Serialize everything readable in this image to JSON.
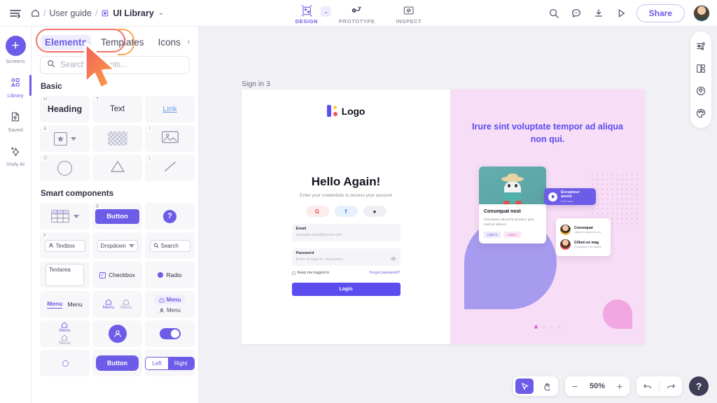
{
  "topbar": {
    "menu_icon": "hamburger-icon",
    "breadcrumb": {
      "home": "home-icon",
      "sep": "/",
      "project": "User guide",
      "file_icon": "file-icon",
      "file": "UI Library",
      "chevron": "⌄"
    },
    "modes": [
      {
        "label": "DESIGN",
        "icon": "design-icon",
        "active": true,
        "chevron": "⌄"
      },
      {
        "label": "PROTOTYPE",
        "icon": "prototype-icon",
        "active": false
      },
      {
        "label": "INSPECT",
        "icon": "inspect-icon",
        "active": false
      }
    ],
    "actions": [
      {
        "name": "search-icon"
      },
      {
        "name": "comment-icon"
      },
      {
        "name": "download-icon"
      },
      {
        "name": "present-icon"
      }
    ],
    "share_label": "Share",
    "avatar": "user-avatar"
  },
  "rail": {
    "items": [
      {
        "label": "Screens",
        "icon": "plus-icon",
        "active": false
      },
      {
        "label": "Library",
        "icon": "library-icon",
        "active": true
      },
      {
        "label": "Saved",
        "icon": "saved-icon",
        "active": false
      },
      {
        "label": "Visily AI",
        "icon": "sparkle-icon",
        "active": false
      }
    ]
  },
  "panel": {
    "tabs": [
      {
        "label": "Elements",
        "active": true
      },
      {
        "label": "Templates",
        "active": false
      },
      {
        "label": "Icons",
        "active": false
      }
    ],
    "collapse_icon": "chevron-left-icon",
    "search": {
      "placeholder": "Search elements...",
      "icon": "search-icon",
      "value": ""
    },
    "sections": [
      {
        "title": "Basic",
        "items": [
          {
            "name": "heading",
            "label": "Heading",
            "kbd": "H"
          },
          {
            "name": "text",
            "label": "Text",
            "kbd": "T"
          },
          {
            "name": "link",
            "label": "Link",
            "kbd": ""
          },
          {
            "name": "icon",
            "label": "",
            "kbd": "A"
          },
          {
            "name": "rectangle",
            "label": "",
            "kbd": ""
          },
          {
            "name": "image",
            "label": "",
            "kbd": "I"
          },
          {
            "name": "circle",
            "label": "",
            "kbd": "O"
          },
          {
            "name": "triangle",
            "label": "",
            "kbd": ""
          },
          {
            "name": "line",
            "label": "",
            "kbd": "L"
          }
        ]
      },
      {
        "title": "Smart components",
        "items": [
          {
            "name": "table",
            "label": "",
            "kbd": ""
          },
          {
            "name": "button",
            "label": "Button",
            "kbd": "B"
          },
          {
            "name": "tooltip",
            "label": "?",
            "kbd": ""
          },
          {
            "name": "textbox",
            "label": "Textbox",
            "kbd": "F"
          },
          {
            "name": "dropdown",
            "label": "Dropdown",
            "kbd": ""
          },
          {
            "name": "search",
            "label": "Search",
            "kbd": ""
          },
          {
            "name": "textarea",
            "label": "Textarea",
            "kbd": ""
          },
          {
            "name": "checkbox",
            "label": "Checkbox",
            "kbd": ""
          },
          {
            "name": "radio",
            "label": "Radio",
            "kbd": ""
          },
          {
            "name": "menu-tabs",
            "label": "Menu",
            "label2": "Menu",
            "kbd": ""
          },
          {
            "name": "menu-icons",
            "label": "Menu",
            "label2": "Menu",
            "kbd": ""
          },
          {
            "name": "menu-list",
            "label": "Menu",
            "label2": "Menu",
            "kbd": ""
          },
          {
            "name": "menu-vertical",
            "label": "Menu",
            "label2": "Menu",
            "kbd": ""
          },
          {
            "name": "avatar",
            "label": "",
            "kbd": ""
          },
          {
            "name": "toggle",
            "label": "",
            "kbd": ""
          },
          {
            "name": "slider",
            "label": "",
            "kbd": ""
          },
          {
            "name": "pill-button",
            "label": "Button",
            "kbd": ""
          },
          {
            "name": "segmented",
            "label": "Left",
            "label2": "Right",
            "kbd": ""
          }
        ]
      }
    ]
  },
  "canvas": {
    "frame_label": "Sign in 3",
    "signin": {
      "logo": "Logo",
      "heading": "Hello Again!",
      "subheading": "Enter your credentials to access your account",
      "socials": [
        {
          "name": "google-icon",
          "glyph": "G"
        },
        {
          "name": "facebook-icon",
          "glyph": "f"
        },
        {
          "name": "apple-icon",
          "glyph": "●"
        }
      ],
      "email": {
        "label": "Email",
        "placeholder": "example.email@gmail.com"
      },
      "password": {
        "label": "Password",
        "placeholder": "Enter at least 8+ characters",
        "eye_icon": "eye-icon"
      },
      "keep_logged_in": "Keep me logged in",
      "forgot": "Forgot password?",
      "login": "Login"
    },
    "promo": {
      "title": "Irure sint voluptate tempor ad aliqua non qui.",
      "product_card": {
        "title": "Consequat nost",
        "description": "Description about the product: quis nostrud ullamco",
        "tags": [
          "Label 1",
          "Label 2"
        ]
      },
      "play_pill": {
        "title": "Excepteur amete",
        "subtitle": "Full name",
        "icon": "play-icon"
      },
      "people": [
        {
          "name": "Consequat",
          "subtitle": "Ullamco nostrud do ea"
        },
        {
          "name": "Cillum ex mag",
          "subtitle": "Consequat exercitation"
        }
      ],
      "carousel": {
        "count": 4,
        "active_index": 0
      }
    }
  },
  "right_rail": {
    "items": [
      {
        "name": "properties-icon"
      },
      {
        "name": "layers-icon"
      },
      {
        "name": "effects-icon"
      },
      {
        "name": "palette-icon"
      }
    ]
  },
  "bottombar": {
    "cursor_tool": "cursor-icon",
    "hand_tool": "hand-icon",
    "zoom_out": "−",
    "zoom_value": "50%",
    "zoom_in": "+",
    "undo": "undo-icon",
    "redo": "redo-icon",
    "help": "?"
  },
  "colors": {
    "accent": "#6c5ce7",
    "highlight_red": "#f4726a",
    "highlight_orange": "#f8a94e",
    "promo_bg": "#f7ddf5"
  }
}
